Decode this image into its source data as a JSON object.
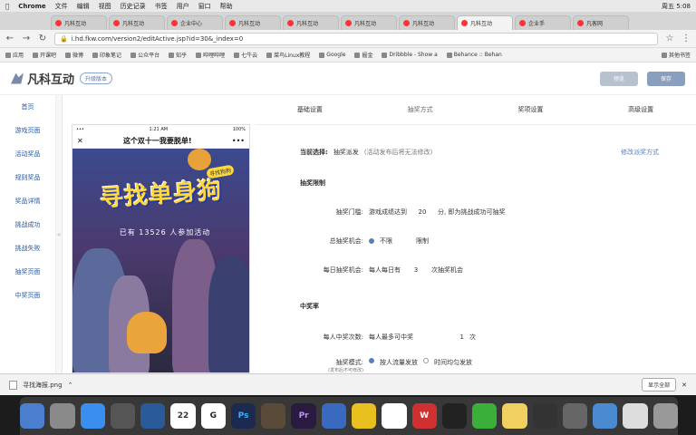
{
  "menubar": {
    "items": [
      "",
      "Chrome",
      "文件",
      "编辑",
      "视图",
      "历史记录",
      "书签",
      "用户",
      "窗口",
      "帮助"
    ],
    "right": [
      "",
      "",
      "",
      "",
      "",
      "",
      "",
      "",
      "",
      "",
      "周五 5:08"
    ]
  },
  "tabs": [
    "凡科互动",
    "凡科互动",
    "企业中心",
    "凡科互动",
    "凡科互动",
    "凡科互动",
    "凡科互动",
    "凡科互动",
    "企业手",
    "凡客网"
  ],
  "address": {
    "url": "i.hd.fkw.com/version2/editActive.jsp?id=30&_index=0"
  },
  "bookmarks": [
    "应用",
    "开课吧",
    "微博",
    "印象笔记",
    "公众平台",
    "知乎",
    "哔哩哔哩",
    "七牛云",
    "菜鸟Linux教程",
    "Google",
    "掘金",
    "Dribbble - Show a",
    "Behance :: Behan",
    "其他书签"
  ],
  "header": {
    "logo": "凡科互动",
    "upgrade": "升级版本 ",
    "preview": "预览",
    "save": "保存"
  },
  "sidebar": {
    "items": [
      "首页",
      "游戏页面",
      "活动奖品",
      "规则奖品",
      "奖品详情",
      "挑战成功",
      "挑战失败",
      "抽奖页面",
      "中奖页面",
      ""
    ],
    "collapse": "«"
  },
  "phone": {
    "time": "1:21 AM",
    "battery": "100%",
    "close": "✕",
    "title": "这个双十一我要脱单!",
    "more": "•••",
    "headline": "寻找单身狗",
    "count": "已有 13526 人参加活动",
    "tag": "寻找狗狗"
  },
  "tabs_right": [
    "基础设置",
    "抽奖方式",
    "奖项设置",
    "高级设置"
  ],
  "form": {
    "current_label": "当前选择:",
    "current_value": "抽奖派发",
    "current_note": "(活动发布后将无法修改)",
    "change_link": "修改派奖方式",
    "section1": "抽奖限制",
    "threshold_label": "抽奖门槛:",
    "threshold_pre": "游戏成绩达到",
    "threshold_value": "20",
    "threshold_post": "分, 即为挑战成功可抽奖",
    "total_label": "总抽奖机会:",
    "total_opt1": "不限",
    "total_opt2": "限制",
    "daily_label": "每日抽奖机会:",
    "daily_pre": "每人每日有",
    "daily_value": "3",
    "daily_post": "次抽奖机会",
    "section2": "中奖率",
    "win_label": "每人中奖次数:",
    "win_pre": "每人最多可中奖",
    "win_value": "1",
    "win_post": "次",
    "mode_label": "抽奖模式:",
    "mode_sub": "(发布后不可修改)",
    "mode_opt1": "按人流量发放",
    "mode_opt2": "时间均匀发放"
  },
  "download": {
    "file": "寻找海报.png",
    "show_all": "显示全部"
  },
  "dock": [
    "",
    "",
    "",
    "",
    "",
    "22",
    "G",
    "Ps",
    "",
    "Pr",
    "",
    "",
    "",
    "W",
    "",
    "",
    "",
    "",
    "",
    "",
    "",
    ""
  ]
}
